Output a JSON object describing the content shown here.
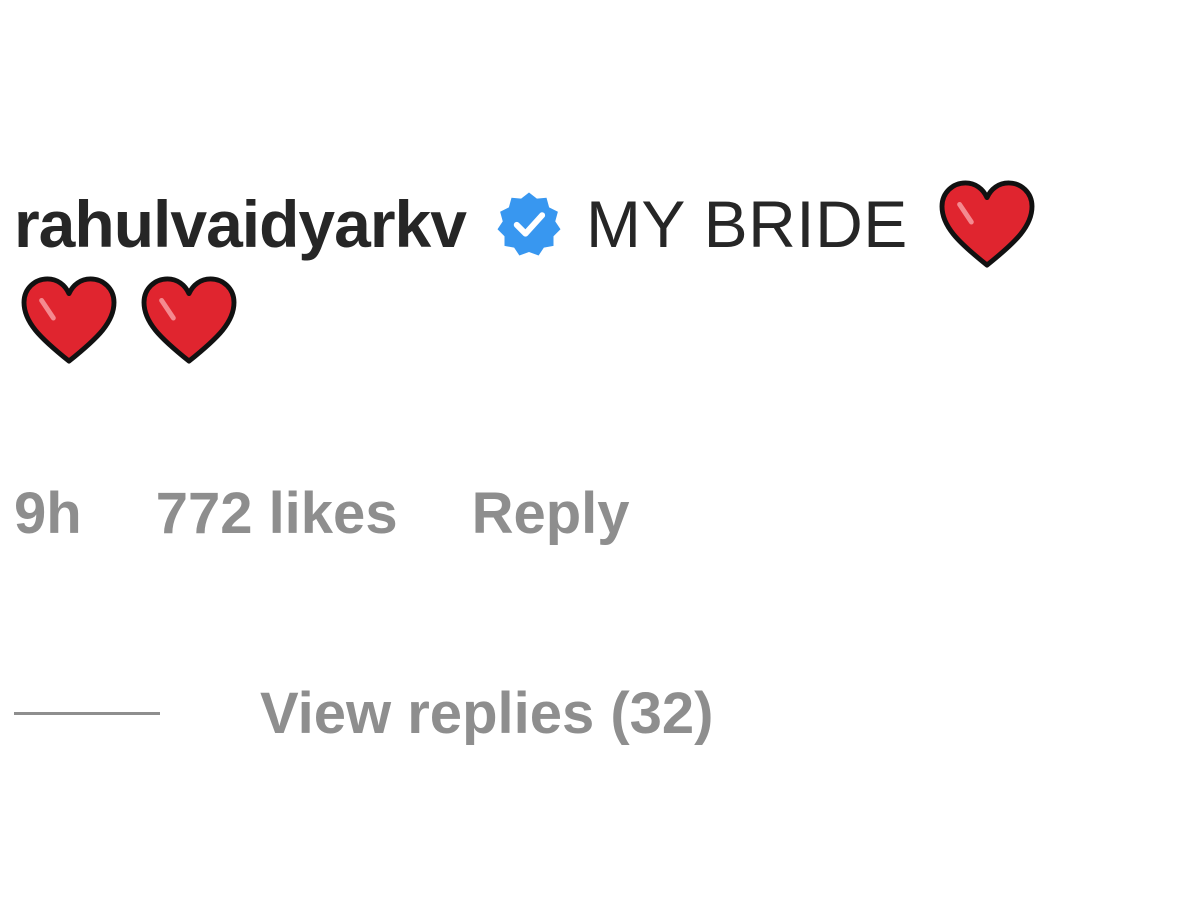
{
  "comment": {
    "username": "rahulvaidyarkv",
    "verified_icon": "verified-badge-icon",
    "text": "MY BRIDE",
    "emoji": "heart-icon",
    "emoji_count": 3
  },
  "meta": {
    "time": "9h",
    "likes": "772 likes",
    "reply_label": "Reply"
  },
  "replies": {
    "view_label": "View replies (32)"
  },
  "colors": {
    "username": "#262626",
    "secondary": "#8e8e8e",
    "verified": "#3897f0",
    "heart": "#e0252f"
  }
}
